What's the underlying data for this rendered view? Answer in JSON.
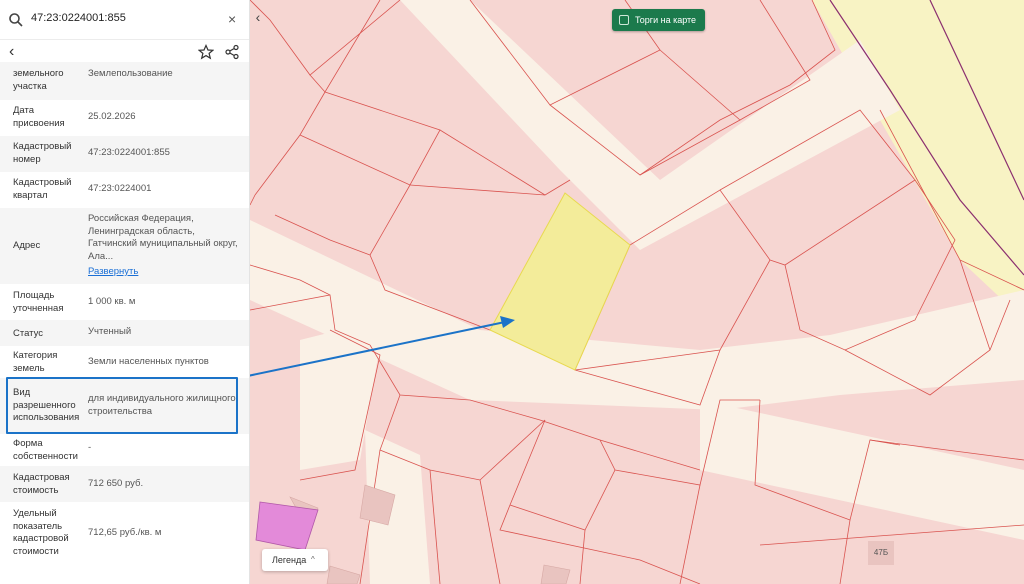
{
  "search": {
    "query": "47:23:0224001:855",
    "clear_label": "×"
  },
  "toolbar": {
    "back_label": "‹"
  },
  "fields": [
    {
      "label": "земельного участка",
      "value": "Землепользование"
    },
    {
      "label": "Дата присвоения",
      "value": "25.02.2026"
    },
    {
      "label": "Кадастровый номер",
      "value": "47:23:0224001:855"
    },
    {
      "label": "Кадастровый квартал",
      "value": "47:23:0224001"
    },
    {
      "label": "Адрес",
      "value": "Российская Федерация, Ленинградская область, Гатчинский муниципальный округ, Ала...",
      "link": "Развернуть"
    },
    {
      "label": "Площадь уточненная",
      "value": "1 000 кв. м"
    },
    {
      "label": "Статус",
      "value": "Учтенный"
    },
    {
      "label": "Категория земель",
      "value": "Земли населенных пунктов"
    },
    {
      "label": "Вид разрешенного использования",
      "value": "для индивидуального жилищного строительства"
    },
    {
      "label": "Форма собственности",
      "value": "-"
    },
    {
      "label": "Кадастровая стоимость",
      "value": "712 650 руб."
    },
    {
      "label": "Удельный показатель кадастровой стоимости",
      "value": "712,65 руб./кв. м"
    }
  ],
  "map": {
    "collapse_label": "‹",
    "torgi_label": "Торги на карте",
    "legend_label": "Легенда",
    "legend_chevron": "^",
    "building_number": "47Б",
    "colors": {
      "parcel_fill": "#f6d6d2",
      "parcel_border": "#d9534f",
      "road": "#faf1e6",
      "selected": "#f3ec9a",
      "zone": "#f8f3c4",
      "arrow": "#1b73c8",
      "purple": "#e38ad9"
    }
  }
}
